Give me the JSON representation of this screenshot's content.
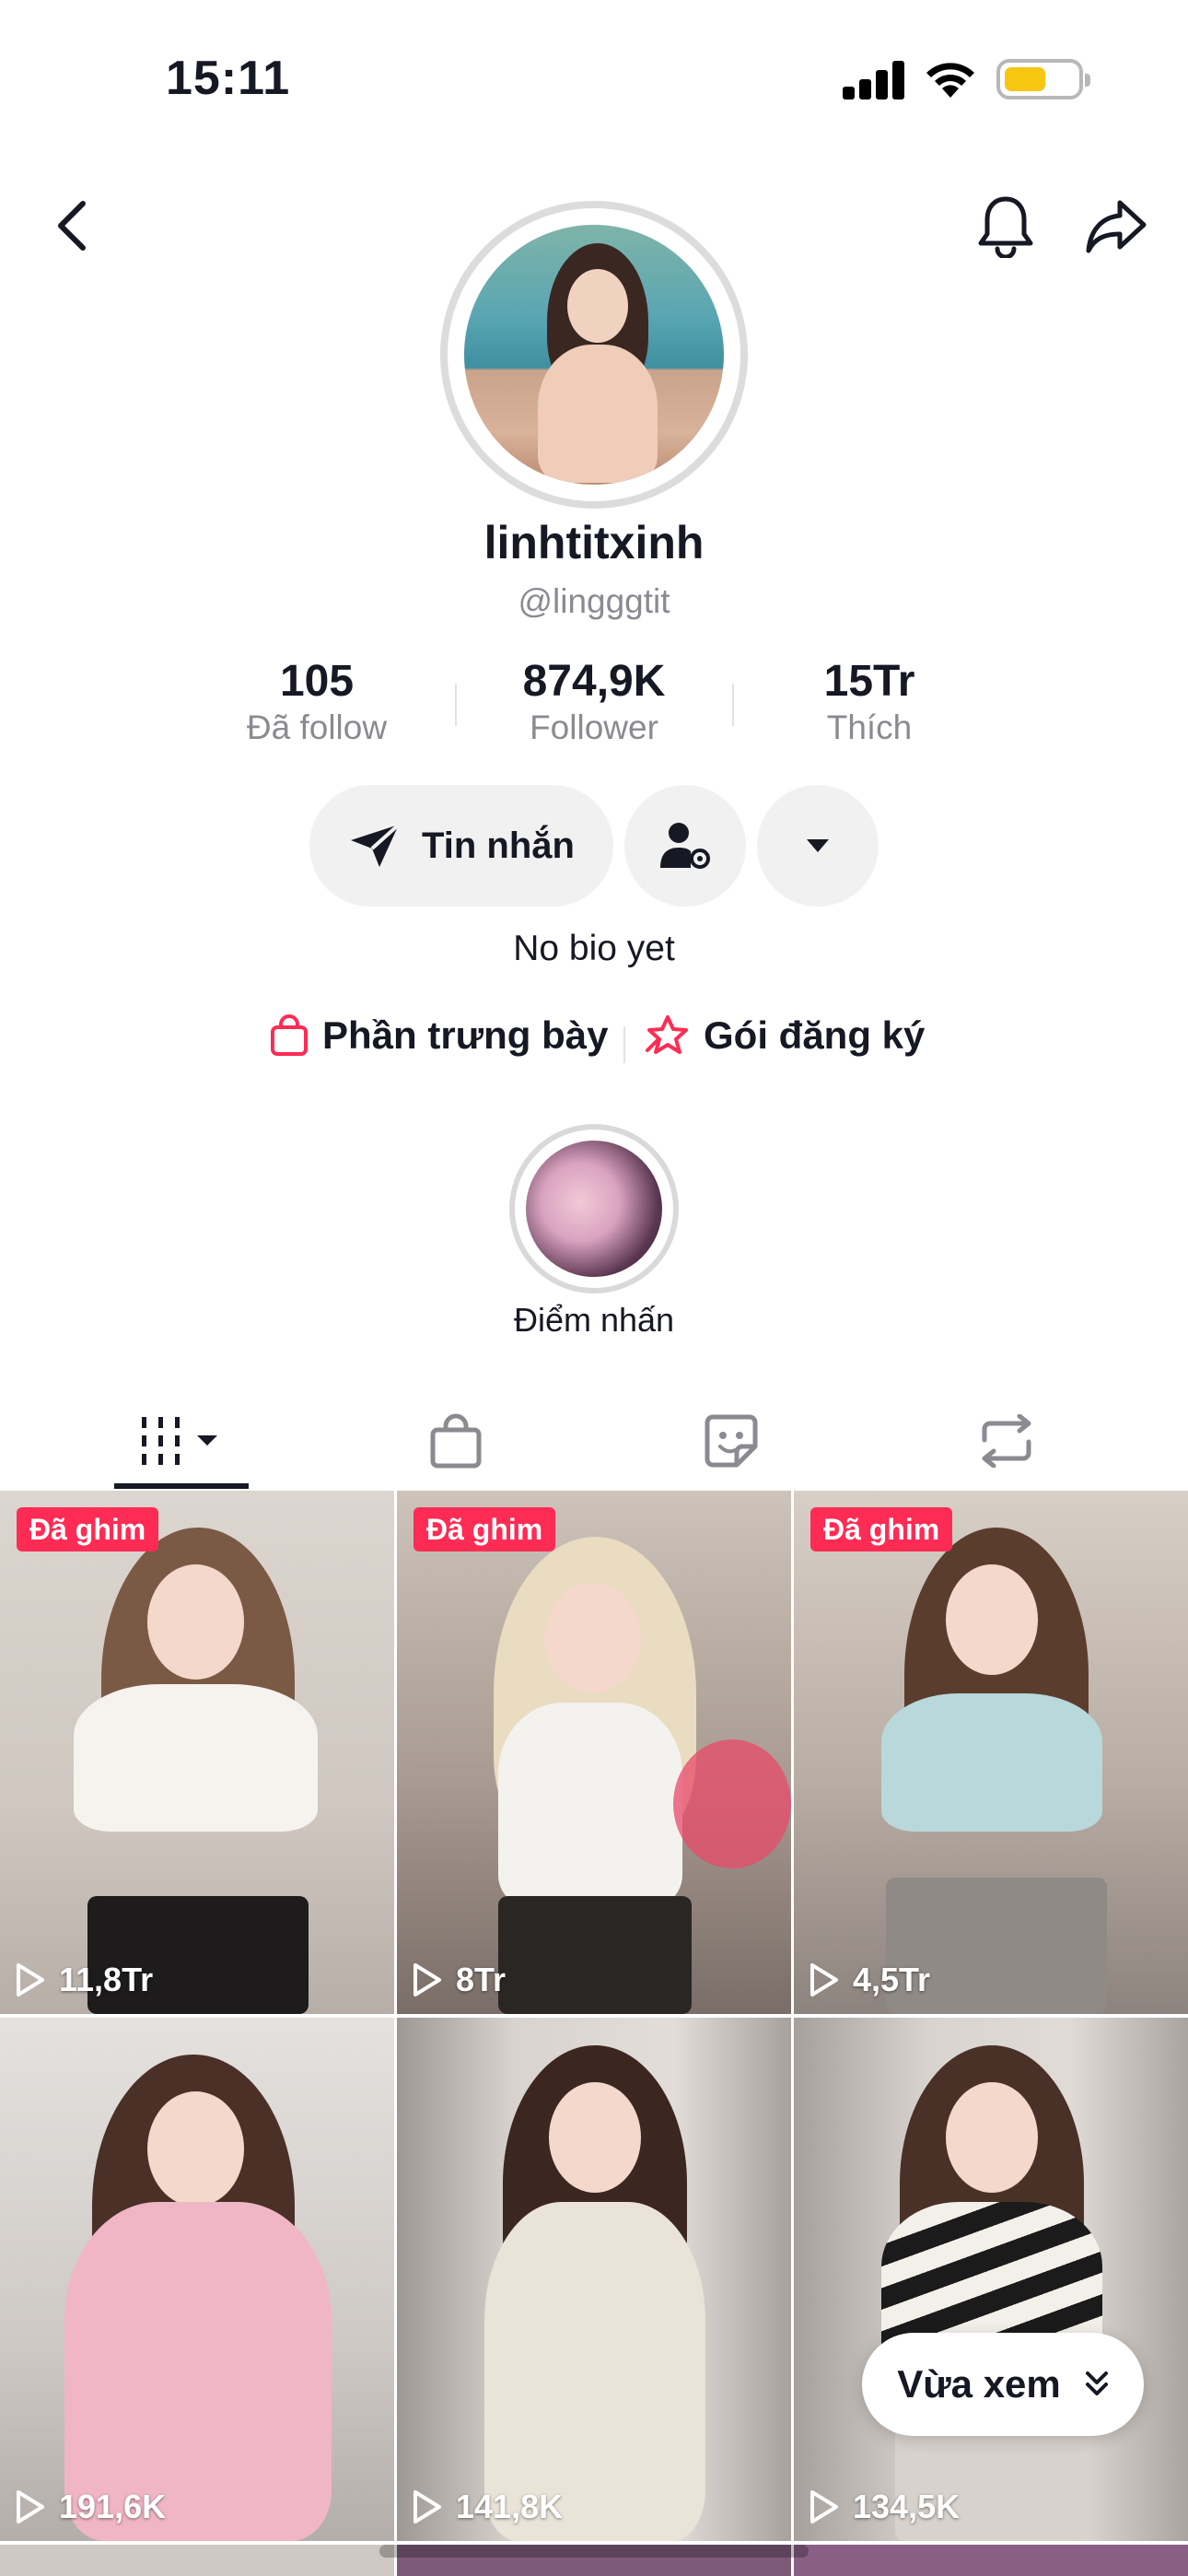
{
  "status_bar": {
    "time": "15:11"
  },
  "profile": {
    "display_name": "linhtitxinh",
    "handle": "@lingggtit",
    "bio": "No bio yet"
  },
  "stats": [
    {
      "value": "105",
      "label": "Đã follow"
    },
    {
      "value": "874,9K",
      "label": "Follower"
    },
    {
      "value": "15Tr",
      "label": "Thích"
    }
  ],
  "actions": {
    "message_label": "Tin nhắn"
  },
  "links": [
    {
      "label": "Phần trưng bày",
      "icon": "shopping-bag-icon"
    },
    {
      "label": "Gói đăng ký",
      "icon": "subscription-star-icon"
    }
  ],
  "highlight": {
    "label": "Điểm nhấn"
  },
  "tabs": [
    {
      "icon": "videos-grid-icon",
      "active": true
    },
    {
      "icon": "shop-bag-icon"
    },
    {
      "icon": "sticker-icon"
    },
    {
      "icon": "repost-icon"
    }
  ],
  "videos": [
    {
      "pinned_label": "Đã ghim",
      "views": "11,8Tr"
    },
    {
      "pinned_label": "Đã ghim",
      "views": "8Tr"
    },
    {
      "pinned_label": "Đã ghim",
      "views": "4,5Tr"
    },
    {
      "views": "191,6K"
    },
    {
      "views": "141,8K"
    },
    {
      "views": "134,5K"
    }
  ],
  "floating": {
    "recent_label": "Vừa xem"
  },
  "colors": {
    "accent": "#fe2c55",
    "text": "#161823",
    "muted": "#8a8b91",
    "button_bg": "#f1f1f2"
  }
}
